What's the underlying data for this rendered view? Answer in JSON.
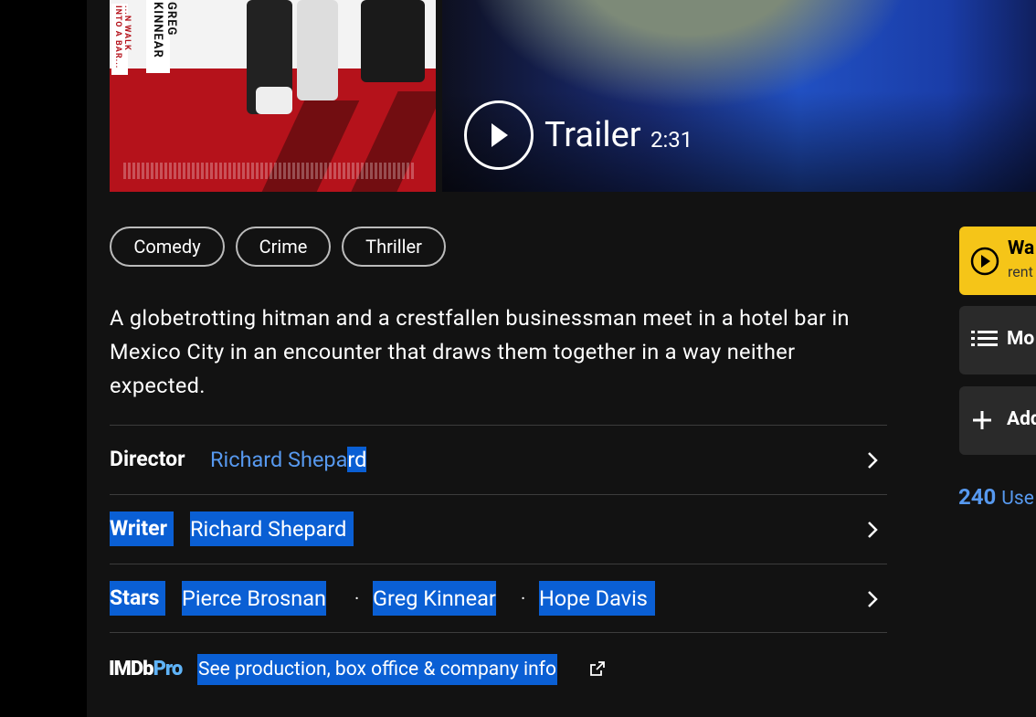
{
  "poster": {
    "actor_text": "GREG KINNEAR",
    "tagline": "...N WALK INTO A BAR..."
  },
  "trailer": {
    "label": "Trailer",
    "duration": "2:31"
  },
  "genres": [
    "Comedy",
    "Crime",
    "Thriller"
  ],
  "plot": "A globetrotting hitman and a crestfallen businessman meet in a hotel bar in Mexico City in an encounter that draws them together in a way neither expected.",
  "credits": {
    "director": {
      "label": "Director",
      "name_a": "Richard Shepa",
      "name_b": "rd"
    },
    "writer": {
      "label": "Writer",
      "name": "Richard Shepard"
    },
    "stars": {
      "label": "Stars",
      "names": [
        "Pierce Brosnan",
        "Greg Kinnear",
        "Hope Davis"
      ],
      "separator": "·"
    }
  },
  "imdbpro": {
    "logo_a": "IMDb",
    "logo_b": "Pro",
    "link": "See production, box office & company info"
  },
  "side": {
    "watch_title": "Wa",
    "watch_sub": "rent",
    "more_label": "Mo",
    "add_label": "Add",
    "user_count": "240",
    "user_label": "Use"
  },
  "colors": {
    "accent_yellow": "#f5c518",
    "link_blue": "#5799ef",
    "selection": "#0a5fd4",
    "background": "#121212"
  }
}
